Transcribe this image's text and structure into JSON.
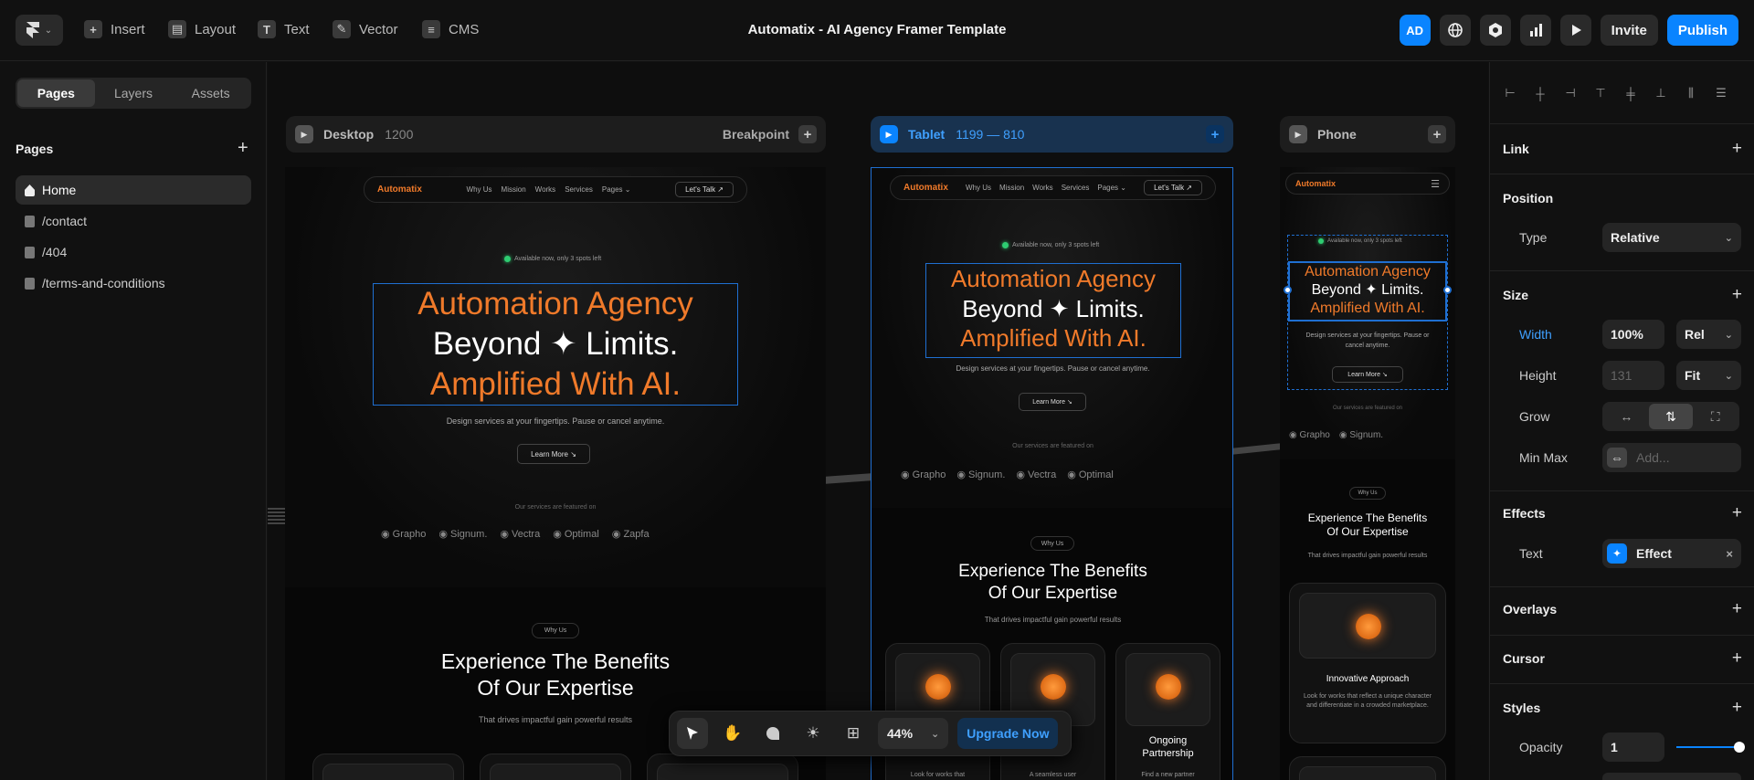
{
  "topbar": {
    "title": "Automatix - AI Agency Framer Template",
    "tools": [
      {
        "label": "Insert",
        "icon": "plus-square-icon",
        "glyph": "+"
      },
      {
        "label": "Layout",
        "icon": "layout-icon",
        "glyph": "▤"
      },
      {
        "label": "Text",
        "icon": "text-icon",
        "glyph": "T"
      },
      {
        "label": "Vector",
        "icon": "pen-icon",
        "glyph": "✎"
      },
      {
        "label": "CMS",
        "icon": "database-icon",
        "glyph": "≡"
      }
    ],
    "avatar": "AD",
    "invite": "Invite",
    "publish": "Publish"
  },
  "left": {
    "tabs": [
      "Pages",
      "Layers",
      "Assets"
    ],
    "active_tab": "Pages",
    "section": "Pages",
    "pages": [
      "Home",
      "/contact",
      "/404",
      "/terms-and-conditions"
    ]
  },
  "canvas": {
    "breakpoints": {
      "desktop": {
        "name": "Desktop",
        "dim": "1200",
        "right": "Breakpoint"
      },
      "tablet": {
        "name": "Tablet",
        "dim": "1199 — 810"
      },
      "phone": {
        "name": "Phone"
      }
    },
    "site": {
      "brand": "Automatix",
      "nav_links": [
        "Why Us",
        "Mission",
        "Works",
        "Services",
        "Pages ⌄"
      ],
      "cta": "Let's Talk ↗",
      "available": "Available now, only 3 spots left",
      "headline_1": "Automation Agency",
      "headline_2": "Beyond ✦ Limits.",
      "headline_3": "Amplified With AI.",
      "sub": "Design services at your fingertips. Pause or cancel anytime.",
      "learn": "Learn More ↘",
      "featured": "Our services are featured on",
      "logos": [
        "Grapho",
        "Signum.",
        "Vectra",
        "Optimal",
        "Zapfa"
      ],
      "why_us": "Why Us",
      "h2_1": "Experience The Benefits",
      "h2_2": "Of Our Expertise",
      "h2_sub": "That drives impactful gain powerful results",
      "card_title_phone": "Innovative Approach",
      "card_text_phone": "Look for works that reflect a unique character and differentiate in a crowded marketplace.",
      "card_tablet_3_title": "Ongoing Partnership",
      "card_tablet_1_text": "Look for works that",
      "card_tablet_2_text": "A seamless user",
      "card_tablet_3_text": "Find a new partner"
    },
    "toolbar": {
      "zoom": "44%",
      "upgrade": "Upgrade Now"
    }
  },
  "right": {
    "sections": [
      "Link",
      "Position",
      "Size",
      "Effects",
      "Overlays",
      "Cursor",
      "Styles"
    ],
    "position_type_label": "Type",
    "position_type": "Relative",
    "width_label": "Width",
    "width_value": "100%",
    "width_unit": "Rel",
    "height_label": "Height",
    "height_value": "131",
    "height_unit": "Fit",
    "grow_label": "Grow",
    "minmax_label": "Min Max",
    "minmax_placeholder": "Add...",
    "effects_text_label": "Text",
    "effect_chip": "Effect",
    "opacity_label": "Opacity",
    "opacity_value": "1",
    "opacity_level": 1
  }
}
